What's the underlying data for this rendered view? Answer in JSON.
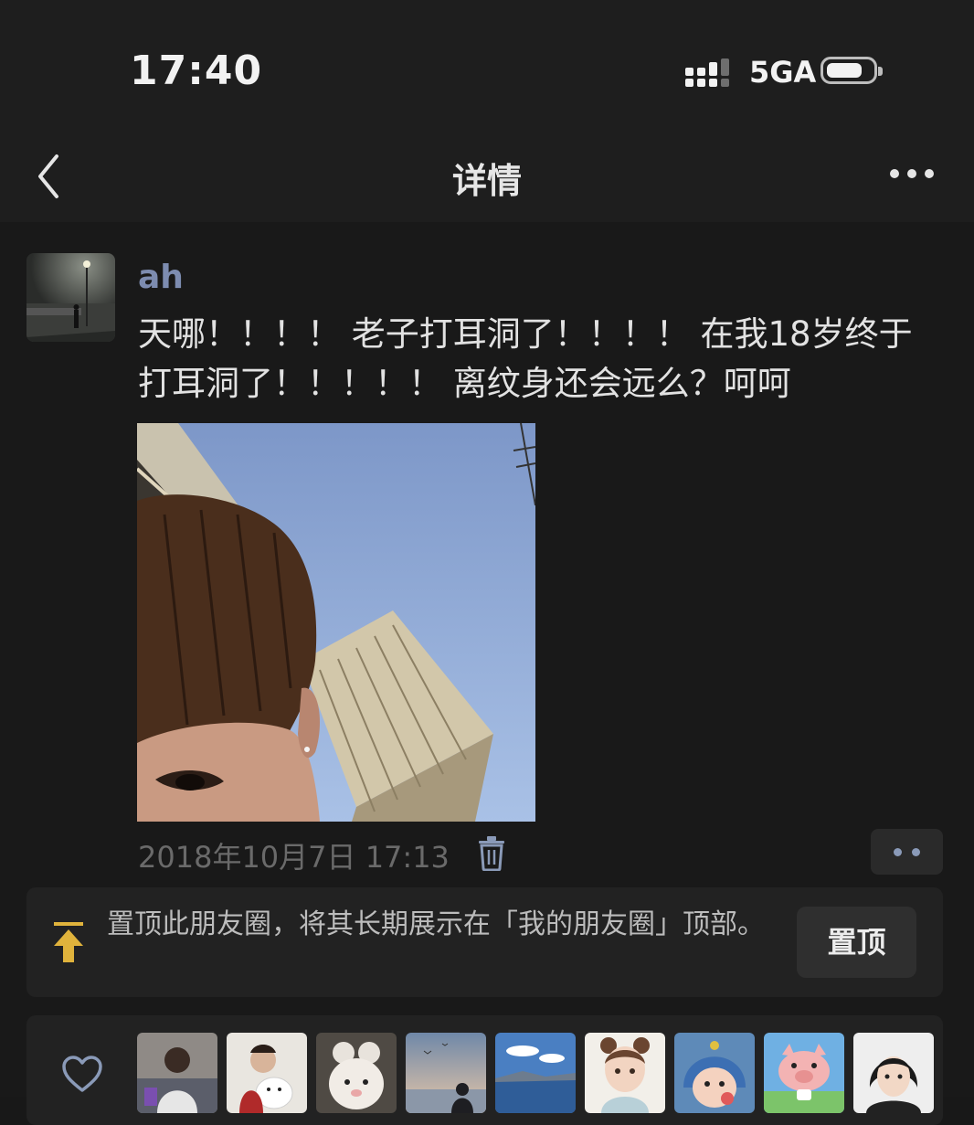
{
  "status_bar": {
    "time": "17:40",
    "network": "5GA"
  },
  "nav": {
    "title": "详情",
    "back_icon": "chevron-left-icon",
    "more_icon": "more-dots-icon"
  },
  "post": {
    "username": "ah",
    "text": "天哪！！！！ 老子打耳洞了！！！！ 在我18岁终于打耳洞了！！！！！ 离纹身还会远么？呵呵",
    "timestamp": "2018年10月7日 17:13"
  },
  "pin": {
    "text": "置顶此朋友圈，将其长期展示在「我的朋友圈」顶部。",
    "button_label": "置顶"
  },
  "likes": {
    "icon": "heart-icon",
    "avatars": [
      "liker-1",
      "liker-2",
      "liker-3",
      "liker-4",
      "liker-5",
      "liker-6",
      "liker-7",
      "liker-8",
      "liker-9"
    ]
  },
  "colors": {
    "background": "#191919",
    "bar": "#1e1e1e",
    "username": "#7d8cb0",
    "pin_icon": "#e0b33c"
  }
}
